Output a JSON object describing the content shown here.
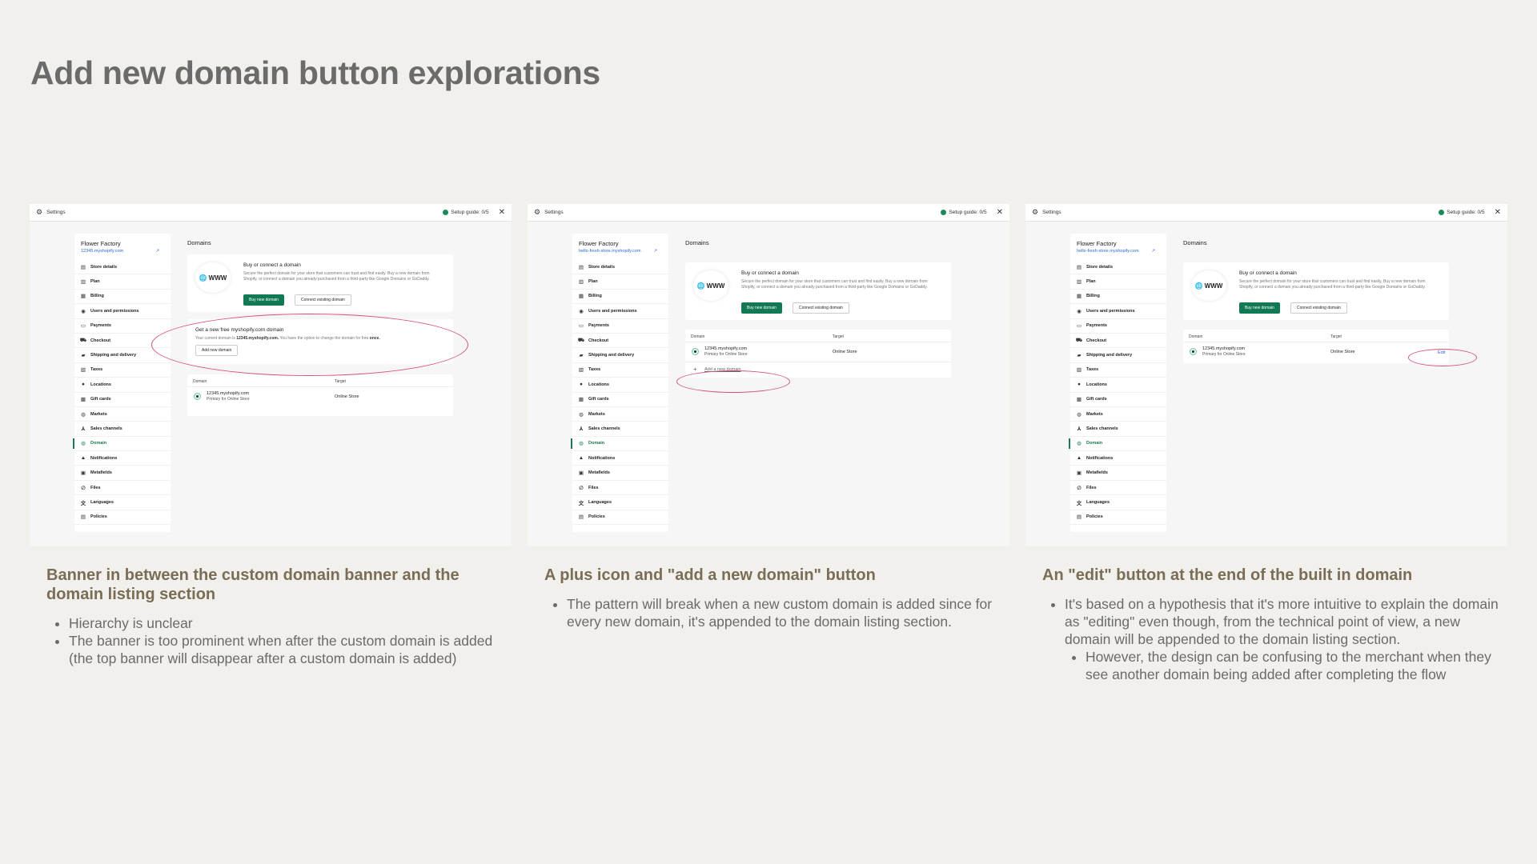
{
  "page": {
    "title": "Add new domain button explorations"
  },
  "shared": {
    "settings_label": "Settings",
    "setup_guide": "Setup guide: 0/5",
    "store_name": "Flower Factory",
    "nav": [
      {
        "label": "Store details",
        "icon": "store-icon"
      },
      {
        "label": "Plan",
        "icon": "plan-icon"
      },
      {
        "label": "Billing",
        "icon": "billing-icon"
      },
      {
        "label": "Users and permissions",
        "icon": "users-icon"
      },
      {
        "label": "Payments",
        "icon": "payments-icon"
      },
      {
        "label": "Checkout",
        "icon": "cart-icon"
      },
      {
        "label": "Shipping and delivery",
        "icon": "truck-icon"
      },
      {
        "label": "Taxes",
        "icon": "taxes-icon"
      },
      {
        "label": "Locations",
        "icon": "location-icon"
      },
      {
        "label": "Gift cards",
        "icon": "gift-icon"
      },
      {
        "label": "Markets",
        "icon": "globe-icon"
      },
      {
        "label": "Sales channels",
        "icon": "channels-icon"
      },
      {
        "label": "Domain",
        "icon": "domain-icon"
      },
      {
        "label": "Notifications",
        "icon": "bell-icon"
      },
      {
        "label": "Metafields",
        "icon": "metafields-icon"
      },
      {
        "label": "Files",
        "icon": "files-icon"
      },
      {
        "label": "Languages",
        "icon": "languages-icon"
      },
      {
        "label": "Policies",
        "icon": "policies-icon"
      }
    ],
    "domains_title": "Domains",
    "www_label": "WWW",
    "buy_title": "Buy or connect a domain",
    "buy_desc": "Secure the perfect domain for your store that customers can trust and find easily. Buy a new domain from Shopify, or connect a domain you already purchased from a third-party like Google Domains or GoDaddy.",
    "buy_button": "Buy new domain",
    "connect_button": "Connect existing domain",
    "col_domain": "Domain",
    "col_target": "Target",
    "row_domain": "12345.myshopify.com",
    "row_sub": "Primary for Online Store",
    "row_target": "Online Store"
  },
  "panels": [
    {
      "store_url": "12345.myshopify.com",
      "banner": {
        "title": "Get a new free myshopify.com domain",
        "desc_pre": "Your current domain is ",
        "desc_domain": "12345.myshopify.com.",
        "desc_mid": " You have the option to change the domain for free ",
        "desc_once": "once.",
        "button": "Add new domain"
      },
      "caption": {
        "title": "Banner in between the custom domain banner and the domain listing section",
        "bullets": [
          "Hierarchy is unclear",
          "The banner is too prominent when after the custom domain is added (the top banner will disappear after a custom domain is added)"
        ]
      }
    },
    {
      "store_url": "hello-fresh-store.myshopify.com",
      "add_link": "Add a new domain",
      "caption": {
        "title": "A plus icon and \"add a new domain\" button",
        "bullets": [
          "The pattern will break when a new custom domain is added since for every new domain, it's appended to the domain listing section."
        ]
      }
    },
    {
      "store_url": "hello-fresh-store.myshopify.com",
      "edit_link": "Edit",
      "caption": {
        "title": "An \"edit\" button at the end of the built in domain",
        "bullets": [
          "It's based on a hypothesis that it's more intuitive to explain the domain as \"editing\" even though, from the technical point of view, a new domain will be appended to the domain listing section."
        ],
        "sub_bullets": [
          "However, the design can be confusing to the merchant when they see another domain being added after completing the flow"
        ]
      }
    }
  ],
  "colors": {
    "accent_green": "#127a52",
    "annotation_pink": "#d4517e",
    "link_blue": "#2a6ad4"
  }
}
